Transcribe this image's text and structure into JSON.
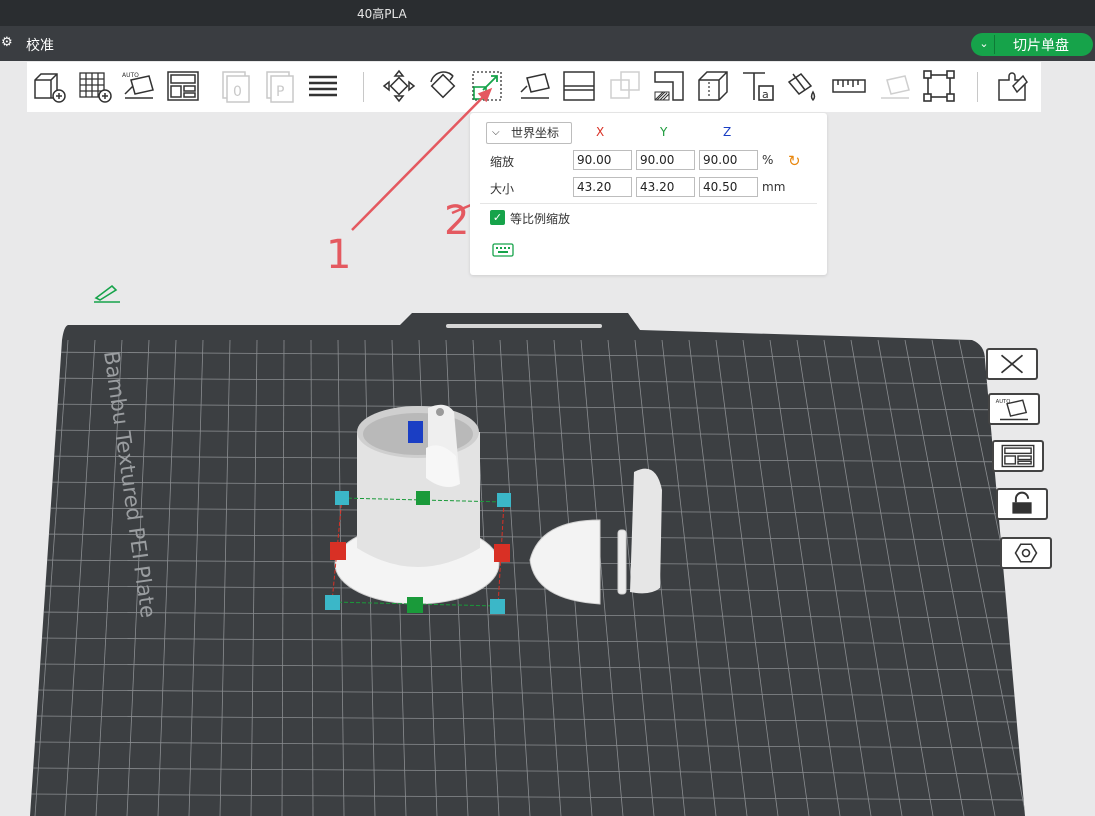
{
  "window": {
    "title": "40高PLA"
  },
  "menubar": {
    "tab_label": "校准",
    "slice_button_label": "切片单盘"
  },
  "toolbar": {
    "icons": [
      "add-cube-icon",
      "grid-icon",
      "auto-orient-icon",
      "arrange-icon",
      "plate-zero-icon",
      "plate-p-icon",
      "layers-icon",
      "move-icon",
      "rotate-icon",
      "scale-icon",
      "lay-on-face-icon",
      "cut-icon",
      "boolean-icon",
      "support-paint-icon",
      "seam-paint-icon",
      "text-icon",
      "color-paint-icon",
      "measure-icon",
      "assembly-icon",
      "fit-view-icon",
      "puzzle-icon"
    ]
  },
  "scale_panel": {
    "coordinate_system": "世界坐标",
    "axes": {
      "x": "X",
      "y": "Y",
      "z": "Z"
    },
    "scale_label": "缩放",
    "size_label": "大小",
    "scale_values": {
      "x": "90.00",
      "y": "90.00",
      "z": "90.00"
    },
    "scale_unit": "%",
    "size_values": {
      "x": "43.20",
      "y": "43.20",
      "z": "40.50"
    },
    "size_unit": "mm",
    "uniform_scale_label": "等比例缩放",
    "uniform_scale_checked": true
  },
  "plate": {
    "name": "Bambu Textured PEI Plate"
  },
  "annotations": {
    "arrow1_label": "1",
    "arrow2_label": "2"
  },
  "colors": {
    "accent": "#16a34a",
    "annotation": "#e45960",
    "axis_x": "#d93025",
    "axis_y": "#1a9a3a",
    "axis_z": "#1a3ec4",
    "plate": "#3c3f42"
  }
}
